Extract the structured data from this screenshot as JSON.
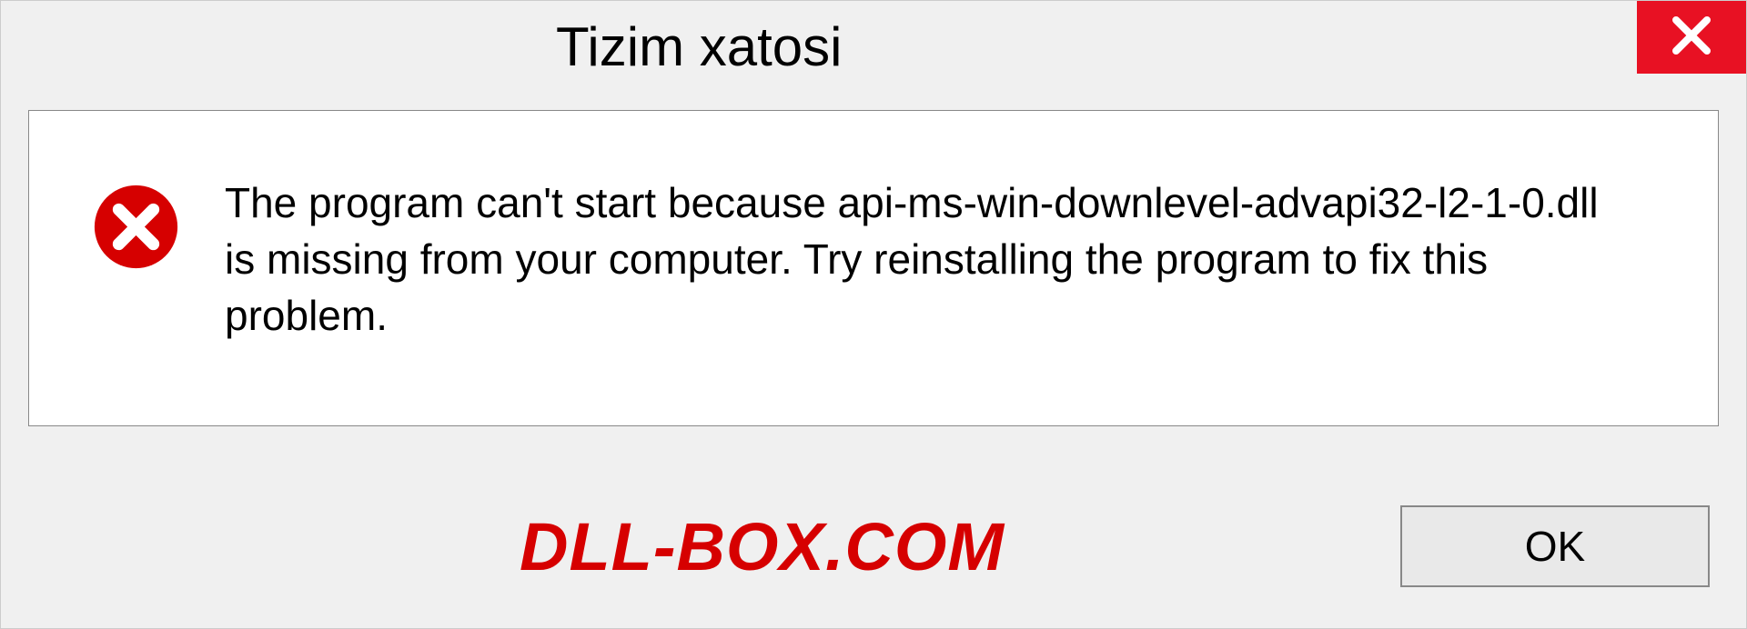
{
  "dialog": {
    "title": "Tizim xatosi",
    "message": "The program can't start because api-ms-win-downlevel-advapi32-l2-1-0.dll is missing from your computer. Try reinstalling the program to fix this problem.",
    "ok_label": "OK"
  },
  "watermark": "DLL-BOX.COM",
  "colors": {
    "close_bg": "#e81123",
    "error_icon": "#d60000",
    "watermark": "#d60000"
  }
}
